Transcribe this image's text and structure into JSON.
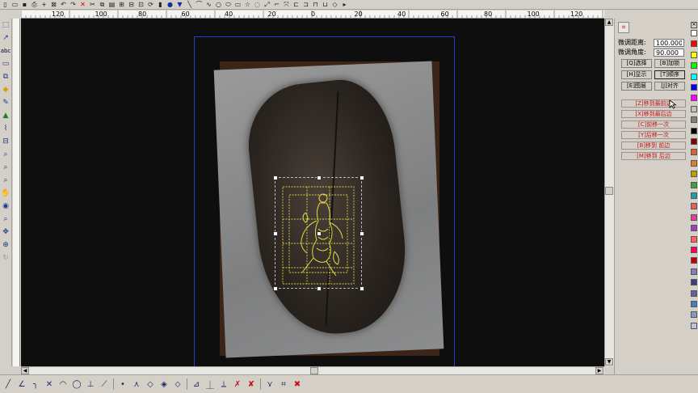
{
  "top_toolbar": {
    "icons": [
      "new-file-icon",
      "open-folder-icon",
      "save-icon",
      "print-icon",
      "crosshair-icon",
      "grid-icon",
      "undo-icon",
      "redo-icon",
      "delete-icon",
      "cut-icon",
      "copy-icon",
      "paste-icon",
      "zoom-in-icon",
      "zoom-out-icon",
      "frame-icon",
      "refresh-icon",
      "lock-icon",
      "badge-icon",
      "shield-icon",
      "line-icon",
      "arc-icon",
      "curve-icon",
      "circle-icon",
      "ellipse-icon",
      "rect-icon",
      "star-icon",
      "node-icon",
      "mirror-icon",
      "path-icon",
      "split-icon",
      "align-icon",
      "distribute-icon",
      "group-icon",
      "weld-icon",
      "trim-icon",
      "more-icon"
    ]
  },
  "ruler_top": {
    "ticks": [
      "120",
      "100",
      "80",
      "60",
      "40",
      "20",
      "0",
      "20",
      "40",
      "60",
      "80",
      "100",
      "120"
    ]
  },
  "right_panel": {
    "tab_label": "⌗",
    "distance_label": "微调距离:",
    "distance_value": "100.000",
    "angle_label": "微调角度:",
    "angle_value": "90.000",
    "buttons": [
      {
        "key": "select",
        "label": "[Q]选择"
      },
      {
        "key": "lock",
        "label": "[B]加锁"
      },
      {
        "key": "show",
        "label": "[H]显示"
      },
      {
        "key": "order",
        "label": "[T]顺序"
      },
      {
        "key": "layer",
        "label": "[E]图层"
      },
      {
        "key": "align",
        "label": "[J]对齐"
      }
    ],
    "order_buttons": [
      {
        "key": "to_front",
        "label": "[Z]移到最前边"
      },
      {
        "key": "to_back",
        "label": "[X]移到最后边"
      },
      {
        "key": "forward_one",
        "label": "[C]前移一次"
      },
      {
        "key": "back_one",
        "label": "[Y]后移一次"
      },
      {
        "key": "move_front",
        "label": "[B]移到      前边"
      },
      {
        "key": "move_back",
        "label": "[M]移到      后边"
      }
    ]
  },
  "palette": {
    "colors": [
      "#ffffff",
      "#ff0000",
      "#ffff00",
      "#00ff00",
      "#00ffff",
      "#0000ff",
      "#ff00ff",
      "#c0c0c0",
      "#808080",
      "#000000",
      "#800000",
      "#e06030",
      "#e08020",
      "#c0a000",
      "#40a040",
      "#20a0a0",
      "#e06060",
      "#e040a0",
      "#a040c0",
      "#ff6060",
      "#ff0060",
      "#c00000",
      "#8080c0",
      "#404080",
      "#6060a0",
      "#4080c0",
      "#80a0c0",
      "#c0c0e0"
    ]
  },
  "bottom_toolbar": {
    "icons": [
      "line-tool-icon",
      "angle-tool-icon",
      "fillet-icon",
      "cross-icon",
      "arc-tool-icon",
      "circle-tool-icon",
      "perpendicular-icon",
      "tangent-icon",
      "node-dot-icon",
      "bezier-icon",
      "diamond-icon",
      "diamond-dual-icon",
      "diamond-alt-icon",
      "extend-icon",
      "trim-tool-icon",
      "break-icon",
      "node-edit-icon",
      "node-delete-icon",
      "smooth-icon",
      "corner-icon",
      "close-red-icon"
    ]
  }
}
